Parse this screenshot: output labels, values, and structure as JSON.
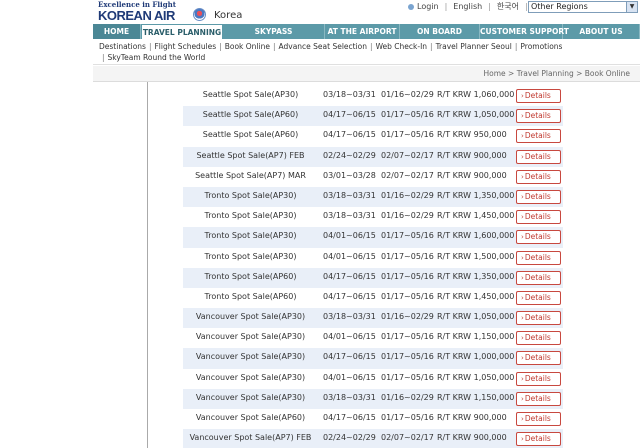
{
  "header": {
    "tagline": "Excellence in Flight",
    "logo": "KOREAN AIR",
    "country": "Korea",
    "util": {
      "login": "Login",
      "english": "English",
      "korean": "한국어"
    },
    "region_select": "Other Regions"
  },
  "main_nav": [
    "HOME",
    "TRAVEL PLANNING",
    "SKYPASS",
    "AT THE AIRPORT",
    "ON BOARD",
    "CUSTOMER SUPPORT",
    "ABOUT US"
  ],
  "sub_nav": {
    "row1": [
      "Destinations",
      "Flight Schedules",
      "Book Online",
      "Advance Seat Selection",
      "Web Check-In",
      "Travel Planner Seoul",
      "Promotions"
    ],
    "row2": [
      "SkyTeam Round the World"
    ]
  },
  "breadcrumb": "Home > Travel Planning > Book Online",
  "details_label": "Details",
  "fares": [
    {
      "name": "Seattle Spot Sale(AP30)",
      "travel": "03/18~03/31",
      "book": "01/16~02/29",
      "fare": "R/T KRW 1,060,000"
    },
    {
      "name": "Seattle Spot Sale(AP60)",
      "travel": "04/17~06/15",
      "book": "01/17~05/16",
      "fare": "R/T KRW 1,050,000"
    },
    {
      "name": "Seattle Spot Sale(AP60)",
      "travel": "04/17~06/15",
      "book": "01/17~05/16",
      "fare": "R/T KRW 950,000"
    },
    {
      "name": "Seattle Spot Sale(AP7) FEB",
      "travel": "02/24~02/29",
      "book": "02/07~02/17",
      "fare": "R/T KRW 900,000"
    },
    {
      "name": "Seattle Spot Sale(AP7) MAR",
      "travel": "03/01~03/28",
      "book": "02/07~02/17",
      "fare": "R/T KRW 900,000"
    },
    {
      "name": "Tronto Spot Sale(AP30)",
      "travel": "03/18~03/31",
      "book": "01/16~02/29",
      "fare": "R/T KRW 1,350,000"
    },
    {
      "name": "Tronto Spot Sale(AP30)",
      "travel": "03/18~03/31",
      "book": "01/16~02/29",
      "fare": "R/T KRW 1,450,000"
    },
    {
      "name": "Tronto Spot Sale(AP30)",
      "travel": "04/01~06/15",
      "book": "01/17~05/16",
      "fare": "R/T KRW 1,600,000"
    },
    {
      "name": "Tronto Spot Sale(AP30)",
      "travel": "04/01~06/15",
      "book": "01/17~05/16",
      "fare": "R/T KRW 1,500,000"
    },
    {
      "name": "Tronto Spot Sale(AP60)",
      "travel": "04/17~06/15",
      "book": "01/17~05/16",
      "fare": "R/T KRW 1,350,000"
    },
    {
      "name": "Tronto Spot Sale(AP60)",
      "travel": "04/17~06/15",
      "book": "01/17~05/16",
      "fare": "R/T KRW 1,450,000"
    },
    {
      "name": "Vancouver Spot Sale(AP30)",
      "travel": "03/18~03/31",
      "book": "01/16~02/29",
      "fare": "R/T KRW 1,050,000"
    },
    {
      "name": "Vancouver Spot Sale(AP30)",
      "travel": "04/01~06/15",
      "book": "01/17~05/16",
      "fare": "R/T KRW 1,150,000"
    },
    {
      "name": "Vancouver Spot Sale(AP30)",
      "travel": "04/17~06/15",
      "book": "01/17~05/16",
      "fare": "R/T KRW 1,000,000"
    },
    {
      "name": "Vancouver Spot Sale(AP30)",
      "travel": "04/01~06/15",
      "book": "01/17~05/16",
      "fare": "R/T KRW 1,050,000"
    },
    {
      "name": "Vancouver Spot Sale(AP30)",
      "travel": "03/18~03/31",
      "book": "01/16~02/29",
      "fare": "R/T KRW 1,150,000"
    },
    {
      "name": "Vancouver Spot Sale(AP60)",
      "travel": "04/17~06/15",
      "book": "01/17~05/16",
      "fare": "R/T KRW 900,000"
    },
    {
      "name": "Vancouver Spot Sale(AP7) FEB",
      "travel": "02/24~02/29",
      "book": "02/07~02/17",
      "fare": "R/T KRW 900,000"
    }
  ]
}
